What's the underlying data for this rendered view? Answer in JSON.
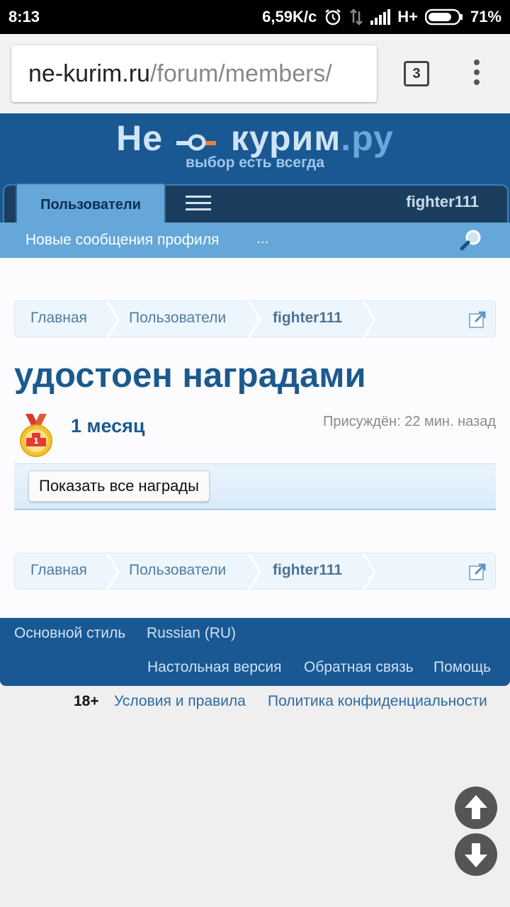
{
  "statusbar": {
    "time": "8:13",
    "speed": "6,59K/с",
    "network": "H+",
    "battery": "71%"
  },
  "browser": {
    "url_host": "ne-kurim.ru",
    "url_path": "/forum/members/",
    "tab_count": "3"
  },
  "site": {
    "logo_left": "Не",
    "logo_right": "курим",
    "logo_tld": ".ру",
    "tagline": "выбор есть всегда"
  },
  "nav": {
    "active_tab": "Пользователи",
    "username": "fighter111",
    "subnav_link": "Новые сообщения профиля",
    "subnav_more": "..."
  },
  "breadcrumb": {
    "items": [
      "Главная",
      "Пользователи",
      "fighter111"
    ]
  },
  "main": {
    "title": "удостоен наградами",
    "award": {
      "name": "1 месяц",
      "awarded": "Присуждён: 22 мин. назад",
      "medal_label": "1"
    },
    "show_all_button": "Показать все награды"
  },
  "footer": {
    "style": "Основной стиль",
    "language": "Russian (RU)",
    "desktop": "Настольная версия",
    "feedback": "Обратная связь",
    "help": "Помощь"
  },
  "legal": {
    "age": "18+",
    "terms": "Условия и правила",
    "privacy": "Политика конфиденциальности"
  },
  "colors": {
    "header_blue": "#195893",
    "subnav_blue": "#64a7d8",
    "link_blue": "#1b5a8f"
  },
  "icons": [
    "alarm-icon",
    "data-arrows-icon",
    "signal-icon",
    "battery-icon",
    "tabs-icon",
    "overflow-menu-icon",
    "hamburger-icon",
    "search-icon",
    "popout-icon",
    "medal-icon",
    "scroll-up-icon",
    "scroll-down-icon"
  ]
}
